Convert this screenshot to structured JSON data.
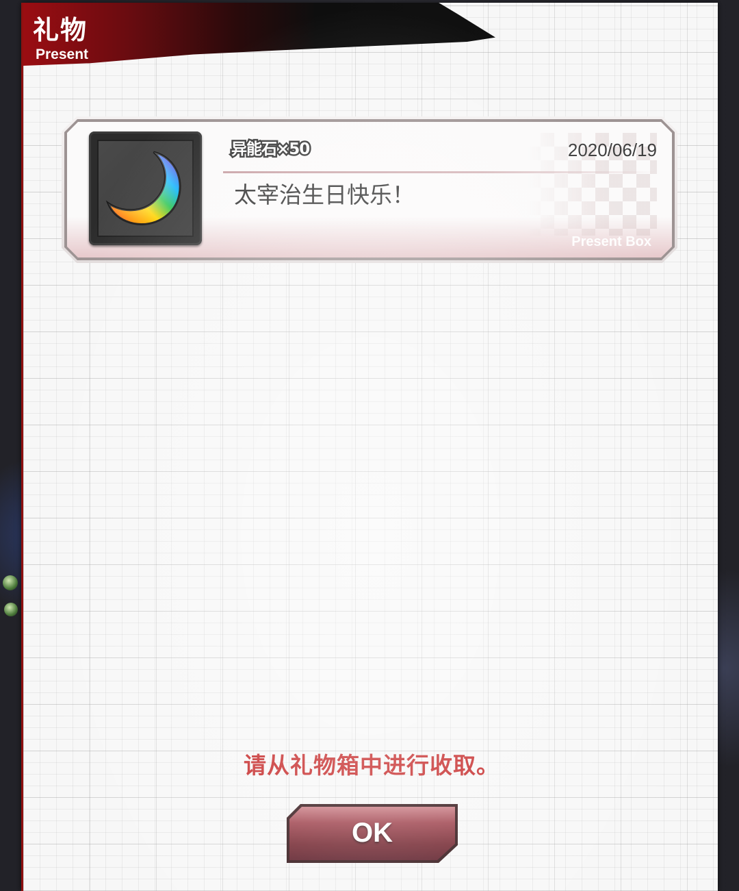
{
  "header": {
    "title": "礼物",
    "subtitle": "Present"
  },
  "present": {
    "item_name": "异能石×50",
    "item_icon": "rainbow-crescent-moon-icon",
    "date": "2020/06/19",
    "message": "太宰治生日快乐！",
    "box_label": "Present Box"
  },
  "footer": {
    "notice": "请从礼物箱中进行收取。",
    "ok_label": "OK"
  },
  "colors": {
    "accent_red": "#9a0d12",
    "notice_red": "#c21d1d",
    "button_maroon": "#6e1e28",
    "paper": "#f7f7f7"
  }
}
